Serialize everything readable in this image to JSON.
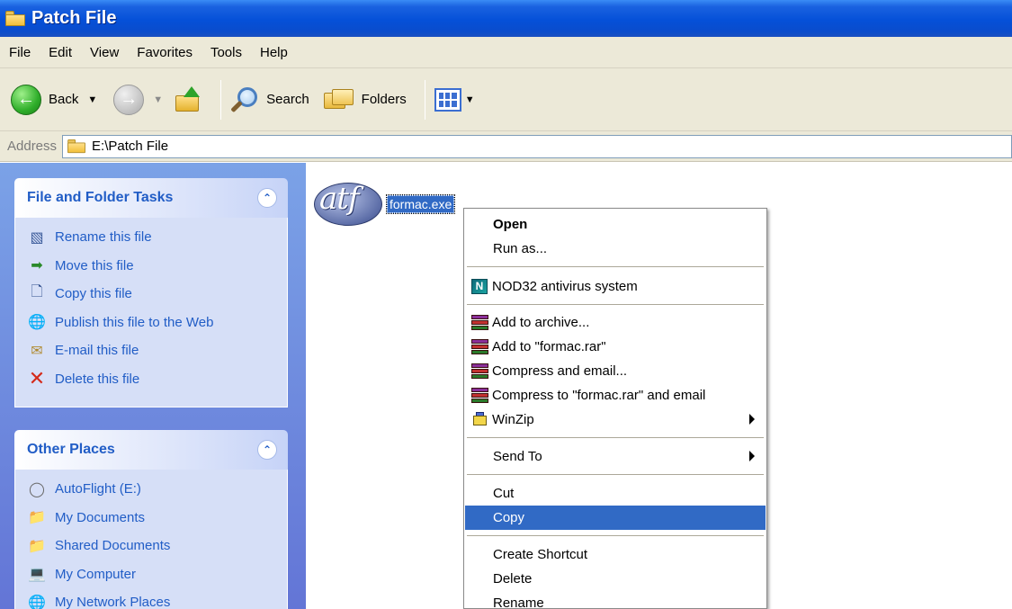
{
  "window": {
    "title": "Patch File"
  },
  "menubar": {
    "items": [
      "File",
      "Edit",
      "View",
      "Favorites",
      "Tools",
      "Help"
    ]
  },
  "toolbar": {
    "back_label": "Back",
    "search_label": "Search",
    "folders_label": "Folders"
  },
  "address": {
    "label": "Address",
    "path": "E:\\Patch File"
  },
  "file_tasks": {
    "title": "File and Folder Tasks",
    "items": [
      {
        "label": "Rename this file",
        "icon": "rename-icon"
      },
      {
        "label": "Move this file",
        "icon": "move-icon"
      },
      {
        "label": "Copy this file",
        "icon": "copy-icon"
      },
      {
        "label": "Publish this file to the Web",
        "icon": "globe-icon"
      },
      {
        "label": "E-mail this file",
        "icon": "email-icon"
      },
      {
        "label": "Delete this file",
        "icon": "delete-x-icon"
      }
    ]
  },
  "other_places": {
    "title": "Other Places",
    "items": [
      {
        "label": "AutoFlight (E:)",
        "icon": "drive-icon"
      },
      {
        "label": "My Documents",
        "icon": "my-documents-icon"
      },
      {
        "label": "Shared Documents",
        "icon": "shared-folder-icon"
      },
      {
        "label": "My Computer",
        "icon": "my-computer-icon"
      },
      {
        "label": "My Network Places",
        "icon": "network-places-icon"
      }
    ]
  },
  "file": {
    "name": "formac.exe",
    "icon_text": "atf"
  },
  "context_menu": {
    "items": [
      {
        "label": "Open",
        "bold": true
      },
      {
        "label": "Run as..."
      },
      {
        "label": "NOD32 antivirus system",
        "icon": "nod32-icon"
      },
      {
        "label": "Add to archive...",
        "icon": "winrar-icon"
      },
      {
        "label": "Add to \"formac.rar\"",
        "icon": "winrar-icon"
      },
      {
        "label": "Compress and email...",
        "icon": "winrar-icon"
      },
      {
        "label": "Compress to \"formac.rar\" and email",
        "icon": "winrar-icon"
      },
      {
        "label": "WinZip",
        "icon": "winzip-icon",
        "submenu": true
      },
      {
        "label": "Send To",
        "submenu": true
      },
      {
        "label": "Cut"
      },
      {
        "label": "Copy",
        "highlighted": true
      },
      {
        "label": "Create Shortcut"
      },
      {
        "label": "Delete"
      },
      {
        "label": "Rename"
      }
    ]
  },
  "colors": {
    "titlebar": "#0550d8",
    "taskpane": "#6375d6",
    "task_link": "#215dc6",
    "selection": "#316ac5"
  }
}
